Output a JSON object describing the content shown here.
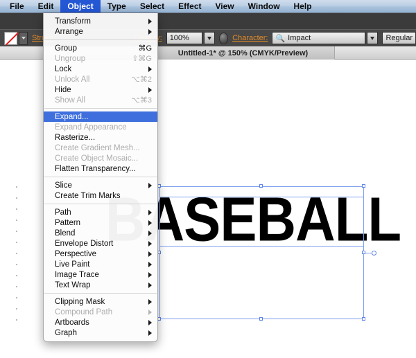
{
  "menubar": {
    "items": [
      {
        "label": "File",
        "active": false
      },
      {
        "label": "Edit",
        "active": false
      },
      {
        "label": "Object",
        "active": true
      },
      {
        "label": "Type",
        "active": false
      },
      {
        "label": "Select",
        "active": false
      },
      {
        "label": "Effect",
        "active": false
      },
      {
        "label": "View",
        "active": false
      },
      {
        "label": "Window",
        "active": false
      },
      {
        "label": "Help",
        "active": false
      }
    ]
  },
  "controlbar": {
    "stroke_label": "Stroke:",
    "stroke_swatch_name": "stroke-none-swatch",
    "opacity_label": "Opacity:",
    "opacity_value": "100%",
    "character_label": "Character:",
    "font_name": "Impact",
    "font_style": "Regular",
    "search_icon": "magnifier-icon",
    "recolor_icon": "recolor-artwork-icon",
    "accent_color": "#e08b2a"
  },
  "tabbar": {
    "document_title": "Untitled-1* @ 150% (CMYK/Preview)"
  },
  "canvas": {
    "artwork_text": "BASEBALL",
    "selection": {
      "handle_color": "#5d85e8",
      "box_color": "#7e9ff0",
      "rotate_handle_name": "rotate-handle"
    }
  },
  "menu": {
    "title": "Object",
    "highlight_color": "#3e6fdd",
    "groups": [
      [
        {
          "label": "Transform",
          "submenu": true,
          "shortcut": "",
          "disabled": false,
          "selected": false
        },
        {
          "label": "Arrange",
          "submenu": true,
          "shortcut": "",
          "disabled": false,
          "selected": false
        }
      ],
      [
        {
          "label": "Group",
          "submenu": false,
          "shortcut": "⌘G",
          "disabled": false,
          "selected": false
        },
        {
          "label": "Ungroup",
          "submenu": false,
          "shortcut": "⇧⌘G",
          "disabled": true,
          "selected": false
        },
        {
          "label": "Lock",
          "submenu": true,
          "shortcut": "",
          "disabled": false,
          "selected": false
        },
        {
          "label": "Unlock All",
          "submenu": false,
          "shortcut": "⌥⌘2",
          "disabled": true,
          "selected": false
        },
        {
          "label": "Hide",
          "submenu": true,
          "shortcut": "",
          "disabled": false,
          "selected": false
        },
        {
          "label": "Show All",
          "submenu": false,
          "shortcut": "⌥⌘3",
          "disabled": true,
          "selected": false
        }
      ],
      [
        {
          "label": "Expand...",
          "submenu": false,
          "shortcut": "",
          "disabled": false,
          "selected": true
        },
        {
          "label": "Expand Appearance",
          "submenu": false,
          "shortcut": "",
          "disabled": true,
          "selected": false
        },
        {
          "label": "Rasterize...",
          "submenu": false,
          "shortcut": "",
          "disabled": false,
          "selected": false
        },
        {
          "label": "Create Gradient Mesh...",
          "submenu": false,
          "shortcut": "",
          "disabled": true,
          "selected": false
        },
        {
          "label": "Create Object Mosaic...",
          "submenu": false,
          "shortcut": "",
          "disabled": true,
          "selected": false
        },
        {
          "label": "Flatten Transparency...",
          "submenu": false,
          "shortcut": "",
          "disabled": false,
          "selected": false
        }
      ],
      [
        {
          "label": "Slice",
          "submenu": true,
          "shortcut": "",
          "disabled": false,
          "selected": false
        },
        {
          "label": "Create Trim Marks",
          "submenu": false,
          "shortcut": "",
          "disabled": false,
          "selected": false
        }
      ],
      [
        {
          "label": "Path",
          "submenu": true,
          "shortcut": "",
          "disabled": false,
          "selected": false
        },
        {
          "label": "Pattern",
          "submenu": true,
          "shortcut": "",
          "disabled": false,
          "selected": false
        },
        {
          "label": "Blend",
          "submenu": true,
          "shortcut": "",
          "disabled": false,
          "selected": false
        },
        {
          "label": "Envelope Distort",
          "submenu": true,
          "shortcut": "",
          "disabled": false,
          "selected": false
        },
        {
          "label": "Perspective",
          "submenu": true,
          "shortcut": "",
          "disabled": false,
          "selected": false
        },
        {
          "label": "Live Paint",
          "submenu": true,
          "shortcut": "",
          "disabled": false,
          "selected": false
        },
        {
          "label": "Image Trace",
          "submenu": true,
          "shortcut": "",
          "disabled": false,
          "selected": false
        },
        {
          "label": "Text Wrap",
          "submenu": true,
          "shortcut": "",
          "disabled": false,
          "selected": false
        }
      ],
      [
        {
          "label": "Clipping Mask",
          "submenu": true,
          "shortcut": "",
          "disabled": false,
          "selected": false
        },
        {
          "label": "Compound Path",
          "submenu": true,
          "shortcut": "",
          "disabled": true,
          "selected": false
        },
        {
          "label": "Artboards",
          "submenu": true,
          "shortcut": "",
          "disabled": false,
          "selected": false
        },
        {
          "label": "Graph",
          "submenu": true,
          "shortcut": "",
          "disabled": false,
          "selected": false
        }
      ]
    ]
  }
}
